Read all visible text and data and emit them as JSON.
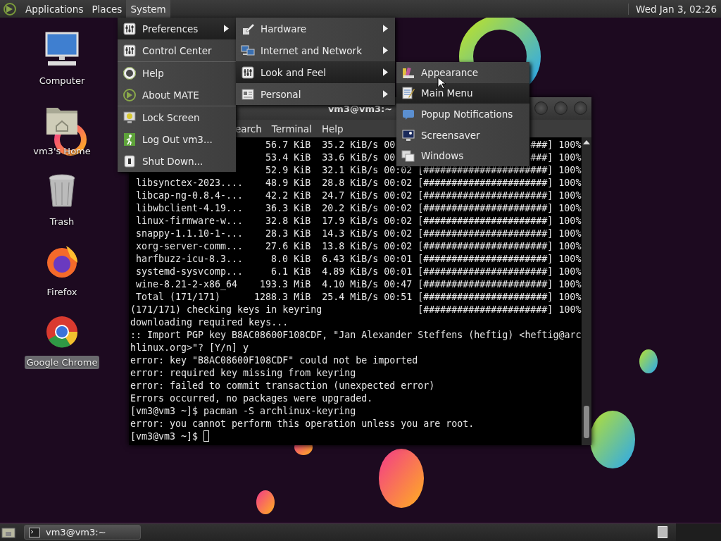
{
  "top_panel": {
    "menus": [
      {
        "label": "Applications",
        "selected": false
      },
      {
        "label": "Places",
        "selected": false
      },
      {
        "label": "System",
        "selected": true
      }
    ],
    "clock": "Wed Jan 3, 02:26"
  },
  "desktop_icons": [
    {
      "label": "Computer",
      "selected": false
    },
    {
      "label": "vm3's Home",
      "selected": false
    },
    {
      "label": "Trash",
      "selected": false
    },
    {
      "label": "Firefox",
      "selected": false
    },
    {
      "label": "Google Chrome",
      "selected": true
    }
  ],
  "terminal": {
    "title": "vm3@vm3:~",
    "menubar": [
      "earch",
      "Terminal",
      "Help"
    ],
    "lines": [
      {
        "kind": "transfer",
        "size": "56.7 KiB",
        "speed": "35.2 KiB/s",
        "time": "00",
        "bar": "###]",
        "pct": "100%"
      },
      {
        "kind": "transfer",
        "size": "53.4 KiB",
        "speed": "33.6 KiB/s",
        "time": "00",
        "bar": "###]",
        "pct": "100%"
      },
      {
        "kind": "transfer",
        "size": "52.9 KiB",
        "speed": "32.1 KiB/s",
        "time": "00:02",
        "bar": "[######################]",
        "pct": "100%"
      },
      {
        "kind": "transfer",
        "name": "libsynctex-2023....",
        "size": "48.9 KiB",
        "speed": "28.8 KiB/s",
        "time": "00:02",
        "bar": "[######################]",
        "pct": "100%"
      },
      {
        "kind": "transfer",
        "name": "libcap-ng-0.8.4-...",
        "size": "42.2 KiB",
        "speed": "24.7 KiB/s",
        "time": "00:02",
        "bar": "[######################]",
        "pct": "100%"
      },
      {
        "kind": "transfer",
        "name": "libwbclient-4.19...",
        "size": "36.3 KiB",
        "speed": "20.2 KiB/s",
        "time": "00:02",
        "bar": "[######################]",
        "pct": "100%"
      },
      {
        "kind": "transfer",
        "name": "linux-firmware-w...",
        "size": "32.8 KiB",
        "speed": "17.9 KiB/s",
        "time": "00:02",
        "bar": "[######################]",
        "pct": "100%"
      },
      {
        "kind": "transfer",
        "name": "snappy-1.1.10-1-...",
        "size": "28.3 KiB",
        "speed": "14.3 KiB/s",
        "time": "00:02",
        "bar": "[######################]",
        "pct": "100%"
      },
      {
        "kind": "transfer",
        "name": "xorg-server-comm...",
        "size": "27.6 KiB",
        "speed": "13.8 KiB/s",
        "time": "00:02",
        "bar": "[######################]",
        "pct": "100%"
      },
      {
        "kind": "transfer",
        "name": "harfbuzz-icu-8.3...",
        "size": "8.0 KiB",
        "speed": "6.43 KiB/s",
        "time": "00:01",
        "bar": "[######################]",
        "pct": "100%"
      },
      {
        "kind": "transfer",
        "name": "systemd-sysvcomp...",
        "size": "6.1 KiB",
        "speed": "4.89 KiB/s",
        "time": "00:01",
        "bar": "[######################]",
        "pct": "100%"
      },
      {
        "kind": "transfer",
        "name": "wine-8.21-2-x86_64",
        "size": "193.3 MiB",
        "speed": "4.10 MiB/s",
        "time": "00:47",
        "bar": "[######################]",
        "pct": "100%"
      },
      {
        "kind": "transfer",
        "name": "Total (171/171)",
        "size": "1288.3 MiB",
        "speed": "25.4 MiB/s",
        "time": "00:51",
        "bar": "[######################]",
        "pct": "100%"
      },
      {
        "kind": "status",
        "text": "(171/171) checking keys in keyring",
        "bar": "[######################]",
        "pct": "100%"
      },
      {
        "kind": "text",
        "text": "downloading required keys..."
      },
      {
        "kind": "text",
        "text": ":: Import PGP key B8AC08600F108CDF, \"Jan Alexander Steffens (heftig) <heftig@arc"
      },
      {
        "kind": "text",
        "text": "hlinux.org>\"? [Y/n] y"
      },
      {
        "kind": "text",
        "text": "error: key \"B8AC08600F108CDF\" could not be imported"
      },
      {
        "kind": "text",
        "text": "error: required key missing from keyring"
      },
      {
        "kind": "text",
        "text": "error: failed to commit transaction (unexpected error)"
      },
      {
        "kind": "text",
        "text": "Errors occurred, no packages were upgraded."
      },
      {
        "kind": "text",
        "text": "[vm3@vm3 ~]$ pacman -S archlinux-keyring"
      },
      {
        "kind": "text",
        "text": "error: you cannot perform this operation unless you are root."
      },
      {
        "kind": "prompt",
        "text": "[vm3@vm3 ~]$"
      }
    ]
  },
  "system_menu": {
    "groups": [
      {
        "items": [
          {
            "label": "Preferences",
            "selected": true,
            "submenu": true
          },
          {
            "label": "Control Center",
            "selected": false,
            "submenu": false
          }
        ]
      },
      {
        "items": [
          {
            "label": "Help",
            "selected": false,
            "submenu": false
          },
          {
            "label": "About MATE",
            "selected": false,
            "submenu": false
          }
        ]
      },
      {
        "items": [
          {
            "label": "Lock Screen",
            "selected": false,
            "submenu": false
          },
          {
            "label": "Log Out vm3...",
            "selected": false,
            "submenu": false
          },
          {
            "label": "Shut Down...",
            "selected": false,
            "submenu": false
          }
        ]
      }
    ]
  },
  "preferences_menu": {
    "items": [
      {
        "label": "Hardware",
        "selected": false,
        "submenu": true
      },
      {
        "label": "Internet and Network",
        "selected": false,
        "submenu": true
      },
      {
        "label": "Look and Feel",
        "selected": true,
        "submenu": true
      },
      {
        "label": "Personal",
        "selected": false,
        "submenu": true
      }
    ]
  },
  "look_and_feel_menu": {
    "items": [
      {
        "label": "Appearance",
        "selected": false,
        "submenu": false
      },
      {
        "label": "Main Menu",
        "selected": true,
        "submenu": false
      },
      {
        "label": "Popup Notifications",
        "selected": false,
        "submenu": false
      },
      {
        "label": "Screensaver",
        "selected": false,
        "submenu": false
      },
      {
        "label": "Windows",
        "selected": false,
        "submenu": false
      }
    ]
  },
  "taskbar": {
    "tasks": [
      {
        "label": "vm3@vm3:~"
      }
    ]
  }
}
